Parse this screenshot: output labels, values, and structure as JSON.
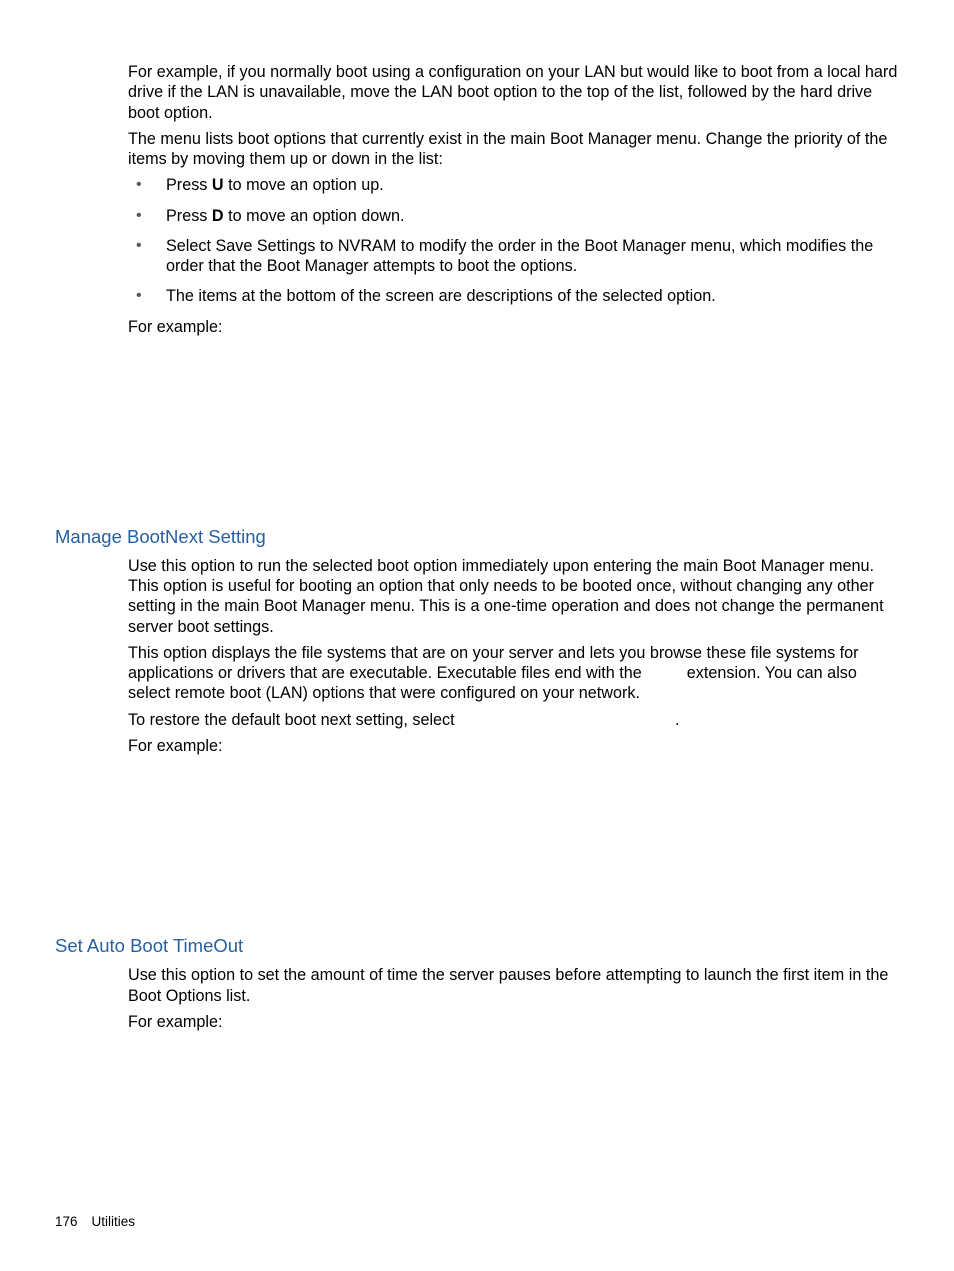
{
  "intro": {
    "p1": "For example, if you normally boot using a configuration on your LAN but would like to boot from a local hard drive if the LAN is unavailable, move the LAN boot option to the top of the list, followed by the hard drive boot option.",
    "p2": "The menu lists boot options that currently exist in the main Boot Manager menu. Change the priority of the items by moving them up or down in the list:",
    "bullets": {
      "b1a": "Press ",
      "b1key": "U",
      "b1b": " to move an option up.",
      "b2a": "Press ",
      "b2key": "D",
      "b2b": " to move an option down.",
      "b3": "Select Save Settings to NVRAM to modify the order in the Boot Manager menu, which modifies the order that the Boot Manager attempts to boot the options.",
      "b4": "The items at the bottom of the screen are descriptions of the selected option."
    },
    "p3": "For example:"
  },
  "section1": {
    "heading": "Manage BootNext Setting",
    "p1": "Use this option to run the selected boot option immediately upon entering the main Boot Manager menu. This option is useful for booting an option that only needs to be booted once, without changing any other setting in the main Boot Manager menu. This is a one-time operation and does not change the permanent server boot settings.",
    "p2a": "This option displays the file systems that are on your server and lets you browse these file systems for applications or drivers that are executable. Executable files end with the ",
    "p2b": " extension. You can also select remote boot (LAN) options that were configured on your network.",
    "p3a": "To restore the default boot next setting, select ",
    "p3b": ".",
    "p4": "For example:"
  },
  "section2": {
    "heading": "Set Auto Boot TimeOut",
    "p1": "Use this option to set the amount of time the server pauses before attempting to launch the first item in the Boot Options list.",
    "p2": "For example:"
  },
  "footer": {
    "page": "176",
    "title": "Utilities"
  }
}
